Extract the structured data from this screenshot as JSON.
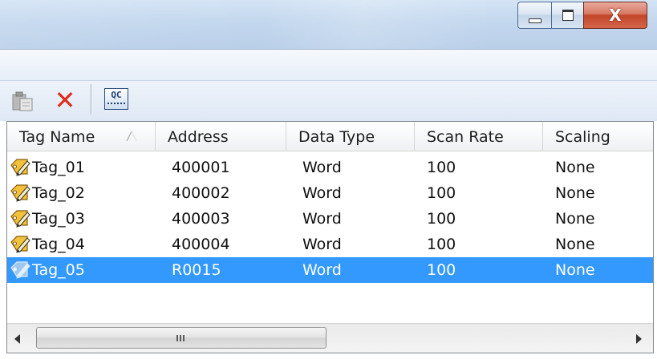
{
  "window": {
    "controls": {
      "minimize_icon": "minimize-icon",
      "maximize_icon": "maximize-icon",
      "close_icon": "close-icon",
      "close_glyph": "X"
    }
  },
  "toolbar": {
    "paste_icon": "paste-icon",
    "delete_icon": "delete-icon",
    "delete_glyph": "✕",
    "qc_icon": "quick-client-icon",
    "qc_label": "QC"
  },
  "table": {
    "columns": [
      "Tag Name",
      "Address",
      "Data Type",
      "Scan Rate",
      "Scaling"
    ],
    "sorted_column": "Tag Name",
    "sort_direction": "ascending",
    "rows": [
      {
        "name": "Tag_01",
        "address": "400001",
        "data_type": "Word",
        "scan_rate": "100",
        "scaling": "None",
        "selected": false
      },
      {
        "name": "Tag_02",
        "address": "400002",
        "data_type": "Word",
        "scan_rate": "100",
        "scaling": "None",
        "selected": false
      },
      {
        "name": "Tag_03",
        "address": "400003",
        "data_type": "Word",
        "scan_rate": "100",
        "scaling": "None",
        "selected": false
      },
      {
        "name": "Tag_04",
        "address": "400004",
        "data_type": "Word",
        "scan_rate": "100",
        "scaling": "None",
        "selected": false
      },
      {
        "name": "Tag_05",
        "address": "R0015",
        "data_type": "Word",
        "scan_rate": "100",
        "scaling": "None",
        "selected": true
      }
    ]
  },
  "colors": {
    "selection": "#3399ff",
    "delete_red": "#e02b1a",
    "tag_icon_yellow": "#f2c23a"
  }
}
